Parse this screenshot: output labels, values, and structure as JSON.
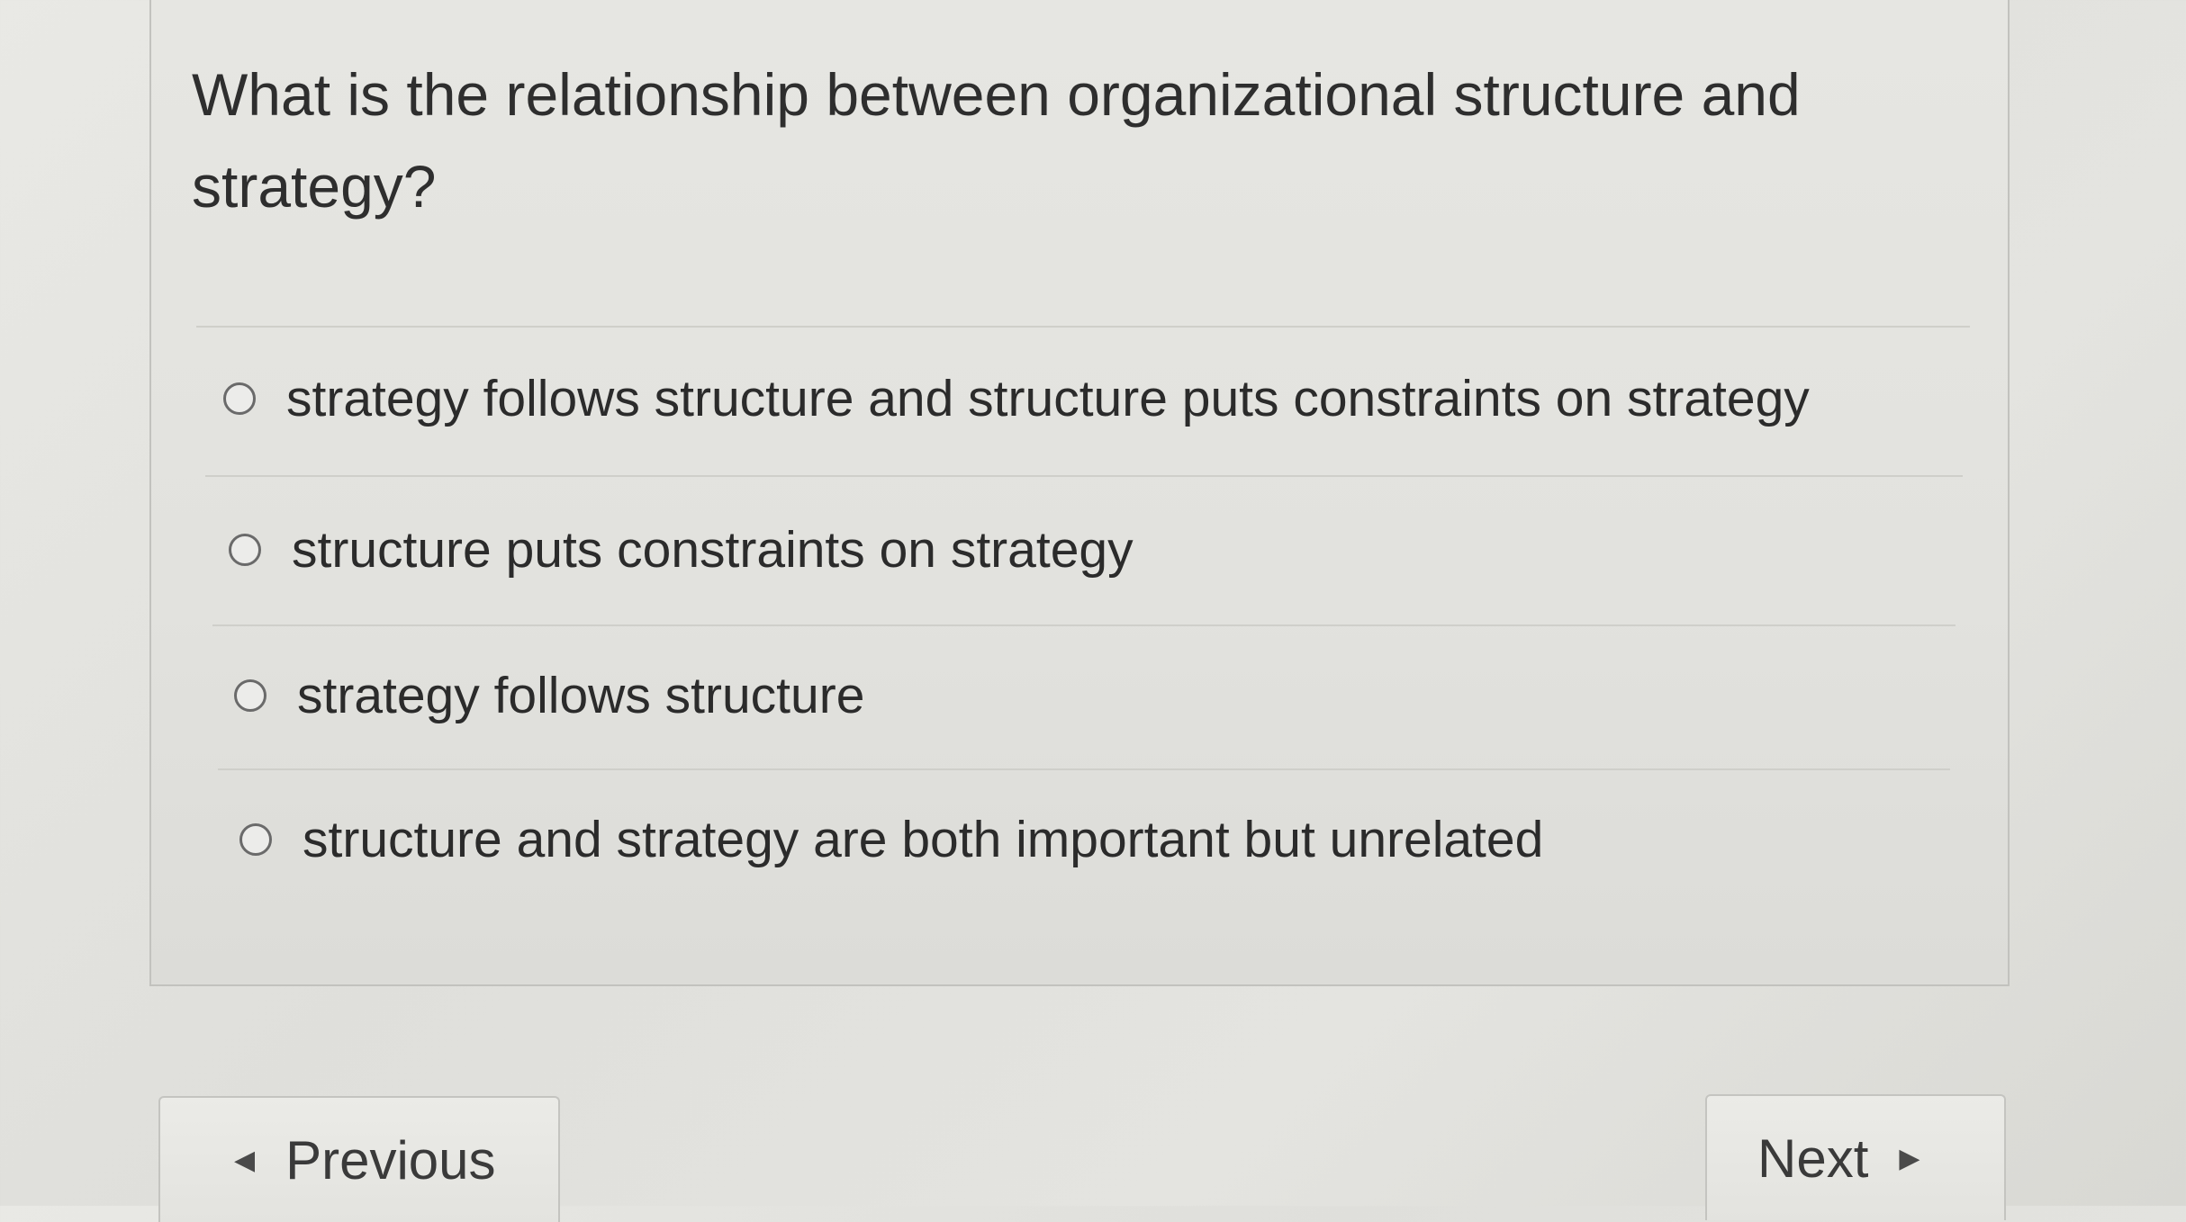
{
  "question": {
    "text": "What is the relationship between organizational structure and strategy?"
  },
  "options": [
    {
      "label": "strategy follows structure and structure puts constraints on strategy",
      "selected": false
    },
    {
      "label": "structure puts constraints on strategy",
      "selected": false
    },
    {
      "label": "strategy follows structure",
      "selected": false
    },
    {
      "label": "structure and strategy are both important but unrelated",
      "selected": false
    }
  ],
  "navigation": {
    "previous_label": "Previous",
    "next_label": "Next",
    "previous_icon": "triangle-left-icon",
    "next_icon": "triangle-right-icon"
  },
  "colors": {
    "background": "#e4e4e0",
    "text": "#2e2e2e",
    "radio_border": "#6a6a6a"
  }
}
